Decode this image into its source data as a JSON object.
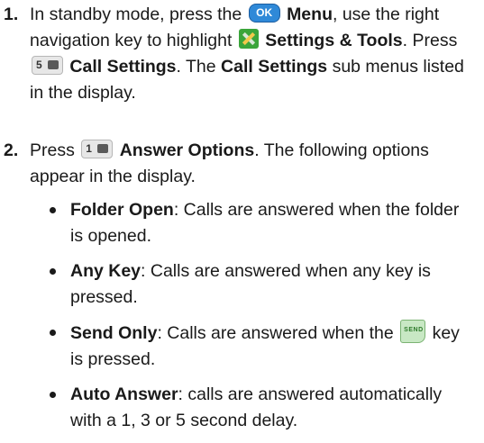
{
  "steps": [
    {
      "number": "1.",
      "t1": "In standby mode, press the ",
      "icon_ok": "OK",
      "b1": "Menu",
      "t2": ", use the right navigation key to highlight ",
      "b2": "Settings & Tools",
      "t3": ". Press ",
      "icon_key": "5",
      "b3": "Call Settings",
      "t4": ". The ",
      "b4": "Call Settings",
      "t5": " sub menus listed in the display."
    },
    {
      "number": "2.",
      "t1": "Press ",
      "icon_key": "1",
      "b1": "Answer Options",
      "t2": ". The following options appear in the display."
    }
  ],
  "options": [
    {
      "term": "Folder Open",
      "desc": ": Calls are answered when the folder is opened."
    },
    {
      "term": "Any Key",
      "desc": ": Calls are answered when any key is pressed."
    },
    {
      "term": "Send Only",
      "desc_before": ": Calls are answered when the ",
      "icon_send": "SEND",
      "desc_after": " key is pressed."
    },
    {
      "term": "Auto Answer",
      "desc": ": calls are answered automatically with a 1, 3 or 5 second delay."
    }
  ]
}
